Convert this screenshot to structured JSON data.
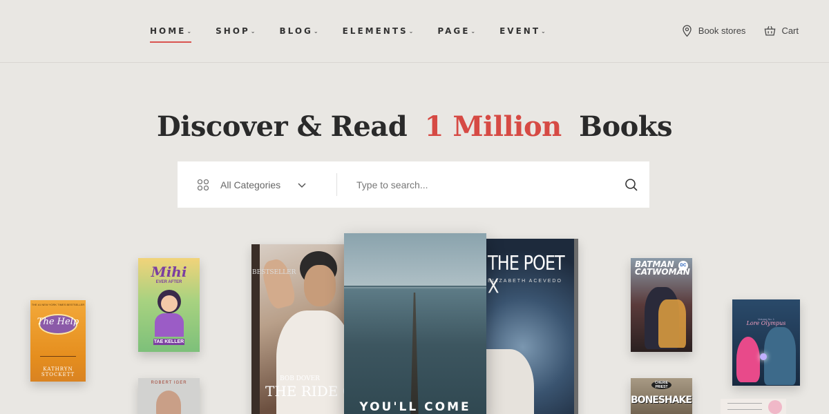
{
  "nav": {
    "items": [
      {
        "label": "HOME",
        "active": true
      },
      {
        "label": "SHOP"
      },
      {
        "label": "BLOG"
      },
      {
        "label": "ELEMENTS"
      },
      {
        "label": "PAGE"
      },
      {
        "label": "EVENT"
      }
    ],
    "chevron": "⌄"
  },
  "header_right": {
    "stores_label": "Book stores",
    "cart_label": "Cart"
  },
  "hero": {
    "title_before": "Discover & Read",
    "title_accent": "1 Million",
    "title_after": "Books",
    "accent_color": "#d64a44"
  },
  "search": {
    "category_label": "All Categories",
    "placeholder": "Type to search..."
  },
  "books": {
    "help": {
      "title": "The Help",
      "subtitle": "a novel",
      "author": "KATHRYN STOCKETT",
      "top": "THE #1 NEW YORK TIMES BESTSELLER"
    },
    "mihi": {
      "title": "Mihi",
      "subtitle": "EVER AFTER",
      "author": "TAE KELLER"
    },
    "iger": {
      "author": "ROBERT IGER"
    },
    "bob": {
      "spine": "BESTSELLER",
      "author": "BOB DOVER",
      "title": "THE RIDE OF A LIFETIME"
    },
    "come": {
      "title": "YOU'LL COME"
    },
    "poet": {
      "title": "THE POET X",
      "author": "ELIZABETH ACEVEDO"
    },
    "bat": {
      "title": "BATMAN CATWOMAN",
      "publisher": "DC"
    },
    "bone": {
      "badge": "CHERIE PRIEST",
      "title": "BONESHAKER"
    },
    "olym": {
      "title": "Lore Olympus",
      "top": "Volume No. 1"
    }
  }
}
